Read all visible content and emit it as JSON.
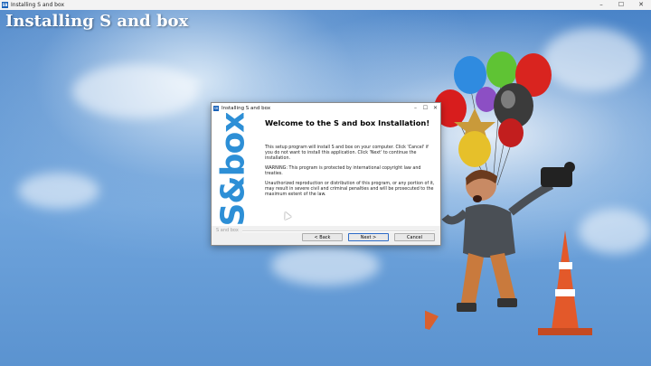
{
  "outer_window": {
    "title": "Installing S and box",
    "icon": "app-icon",
    "controls": [
      "minimize",
      "maximize",
      "close"
    ],
    "heading": "Installing S and box"
  },
  "dialog": {
    "title": "Installing S and box",
    "icon": "app-icon",
    "controls": {
      "minimize": "–",
      "maximize": "☐",
      "close": "✕"
    },
    "logo": "S&box",
    "heading": "Welcome to the S and box Installation!",
    "paragraphs": [
      "This setup program will install S and box on your computer. Click 'Cancel' if you do not want to install this application. Click 'Next' to continue the installation.",
      "WARNING: This program is protected by international copyright law and treaties.",
      "Unauthorized reproduction or distribution of this program, or any portion of it, may result in severe civil and criminal penalties and will be prosecuted to the maximum extent of the law."
    ],
    "footer_brand": "S and box",
    "buttons": {
      "back": "< Back",
      "next": "Next >",
      "cancel": "Cancel"
    }
  },
  "colors": {
    "accent": "#2d8fd6",
    "sky": "#5a93d3"
  }
}
